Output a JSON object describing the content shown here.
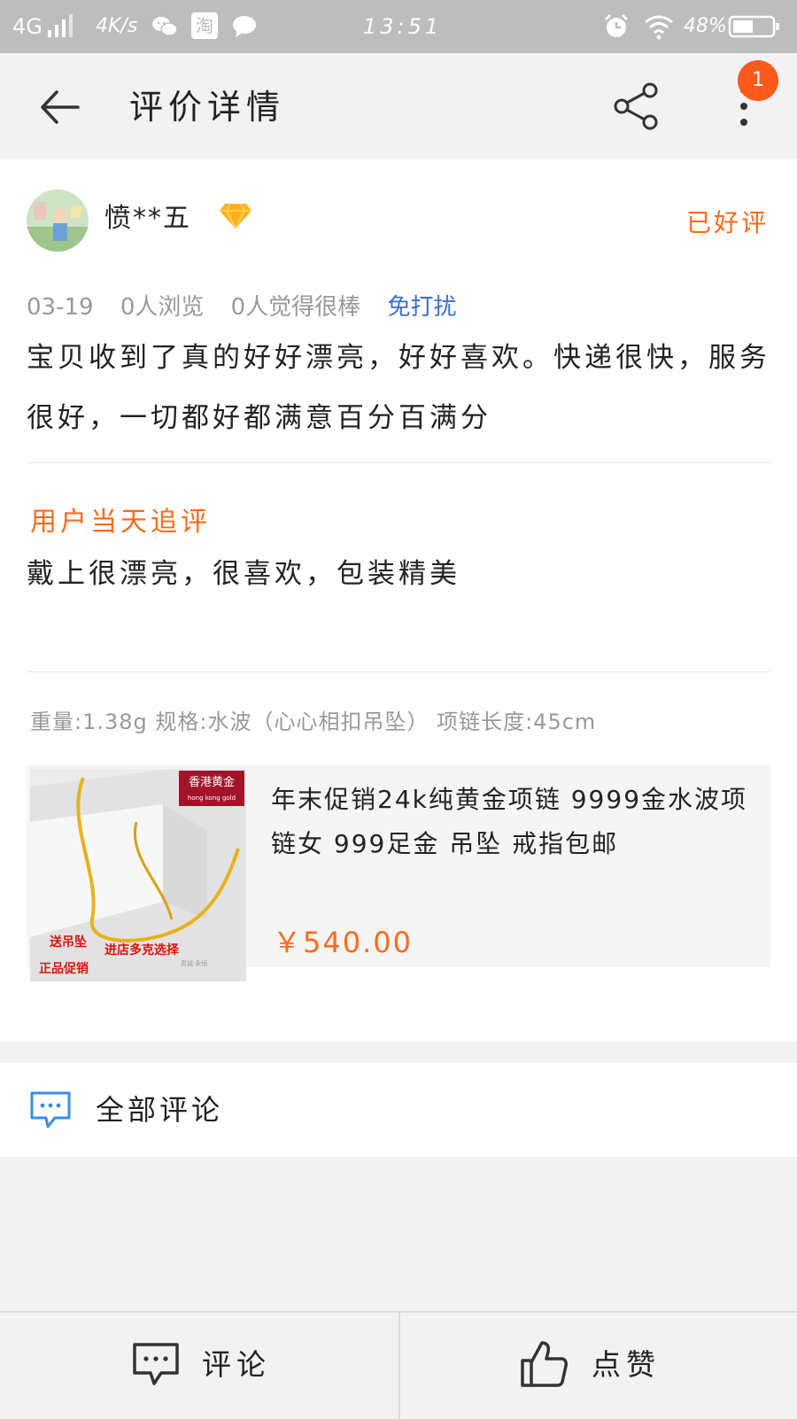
{
  "status_bar": {
    "network": "4G",
    "speed": "4K/s",
    "taobao_glyph": "淘",
    "time": "13:51",
    "battery": "48%",
    "icons": [
      "signal-icon",
      "wechat-icon",
      "taobao-icon",
      "message-icon",
      "alarm-icon",
      "wifi-icon",
      "battery-icon"
    ]
  },
  "header": {
    "title": "评价详情",
    "notification_count": "1",
    "icons": [
      "back-arrow-icon",
      "share-icon",
      "more-icon"
    ]
  },
  "review": {
    "username": "愤**五",
    "status": "已好评",
    "date": "03-19",
    "views": "0人浏览",
    "likes": "0人觉得很棒",
    "dnd": "免打扰",
    "content": "宝贝收到了真的好好漂亮，好好喜欢。快递很快，服务很好，一切都好都满意百分百满分",
    "follow_label": "用户当天追评",
    "follow_content": "戴上很漂亮，很喜欢，包装精美",
    "spec": "重量:1.38g 规格:水波（心心相扣吊坠） 项链长度:45cm"
  },
  "product": {
    "title": "年末促销24k纯黄金项链 9999金水波项链女 999足金 吊坠 戒指包邮",
    "price": "￥540.00",
    "image_text": {
      "brand": "香港黄金",
      "brand_en": "hong kong gold",
      "promo1": "送吊坠",
      "promo2": "进店多克选择",
      "promo3": "正品促销",
      "small": "真诚·永恒"
    }
  },
  "all_comments": {
    "label": "全部评论"
  },
  "bottom_bar": {
    "comment_label": "评论",
    "like_label": "点赞"
  },
  "colors": {
    "accent": "#ff6a1a",
    "link": "#3b6fd0",
    "comment_icon": "#3a8ee6",
    "notif": "#ff5a1a"
  }
}
